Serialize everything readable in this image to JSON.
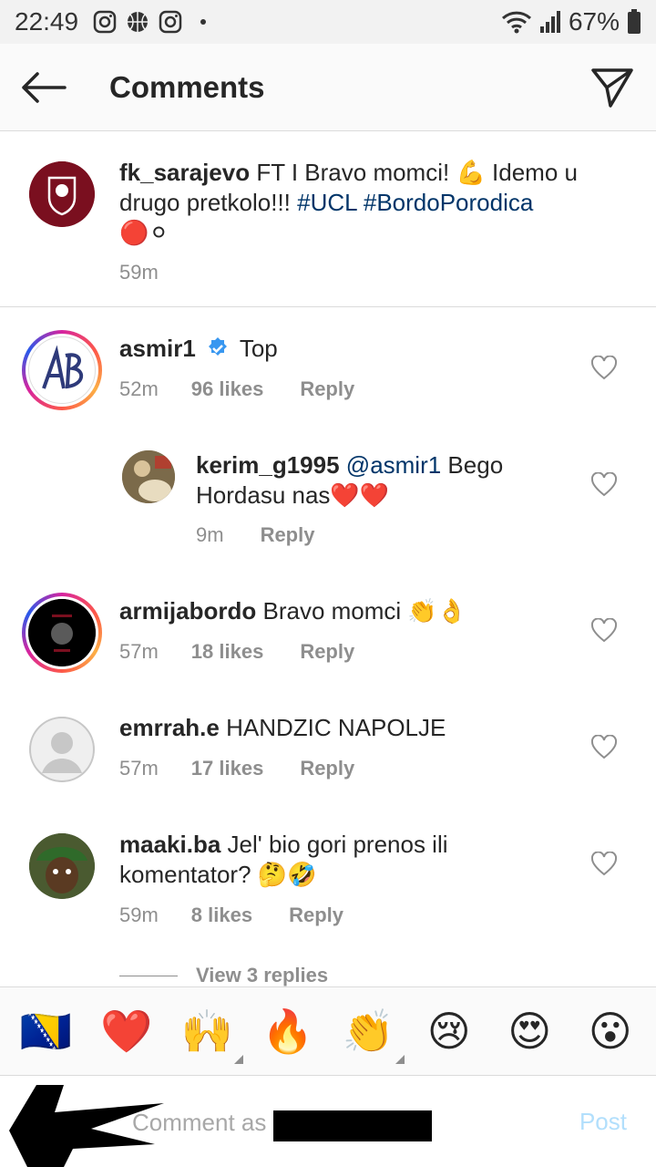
{
  "status_bar": {
    "time": "22:49",
    "battery": "67%",
    "icons_left": [
      "instagram-icon",
      "basketball-icon",
      "instagram-icon",
      "dot-icon"
    ],
    "icons_right": [
      "wifi-icon",
      "signal-icon",
      "battery-icon"
    ]
  },
  "header": {
    "title": "Comments",
    "back_icon": "arrow-left-icon",
    "send_icon": "paper-plane-icon"
  },
  "caption": {
    "username": "fk_sarajevo",
    "text_before": " FT I Bravo momci! 💪 Idemo u drugo pretkolo!!! ",
    "hashtag1": "#UCL",
    "hashtag2": "#BordoPorodica",
    "emoji_line": "🔴⚪",
    "time": "59m"
  },
  "comments": [
    {
      "username": "asmir1",
      "verified": true,
      "text": "Top",
      "time": "52m",
      "likes": "96 likes",
      "reply": "Reply"
    },
    {
      "username": "kerim_g1995",
      "mention": "@asmir1",
      "text": " Bego Hordasu nas❤️❤️",
      "time": "9m",
      "reply": "Reply"
    },
    {
      "username": "armijabordo",
      "text": "Bravo momci 👏👌",
      "time": "57m",
      "likes": "18 likes",
      "reply": "Reply"
    },
    {
      "username": "emrrah.e",
      "text": "HANDZIC NAPOLJE",
      "time": "57m",
      "likes": "17 likes",
      "reply": "Reply"
    },
    {
      "username": "maaki.ba",
      "text": "Jel' bio gori prenos ili komentator? 🤔🤣",
      "time": "59m",
      "likes": "8 likes",
      "reply": "Reply"
    }
  ],
  "view_replies": "View 3 replies",
  "emoji_bar": [
    "🇧🇦",
    "❤️",
    "🙌",
    "🔥",
    "👏",
    "😢",
    "😍",
    "😮"
  ],
  "compose": {
    "placeholder": "Comment as",
    "post": "Post"
  },
  "colors": {
    "hashtag": "#003569",
    "meta": "#8e8e8e",
    "post_disabled": "#b2dffc",
    "verified": "#3897f0"
  }
}
